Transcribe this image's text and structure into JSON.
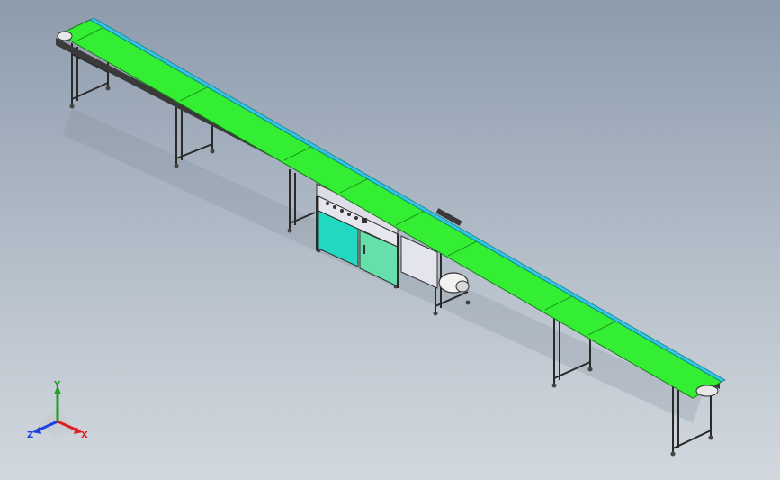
{
  "colors": {
    "belt": "#33ee33",
    "belt_dark": "#22bb22",
    "side_rail": "#33c6e0",
    "frame": "#2a2a2a",
    "cabinet_left": "#22d8c0",
    "cabinet_right": "#66e0aa",
    "panel": "#dddde6",
    "axis_x": "#e02020",
    "axis_y": "#20a020",
    "axis_z": "#2040e0"
  },
  "triad": {
    "x_label": "X",
    "y_label": "Y",
    "z_label": "Z"
  }
}
